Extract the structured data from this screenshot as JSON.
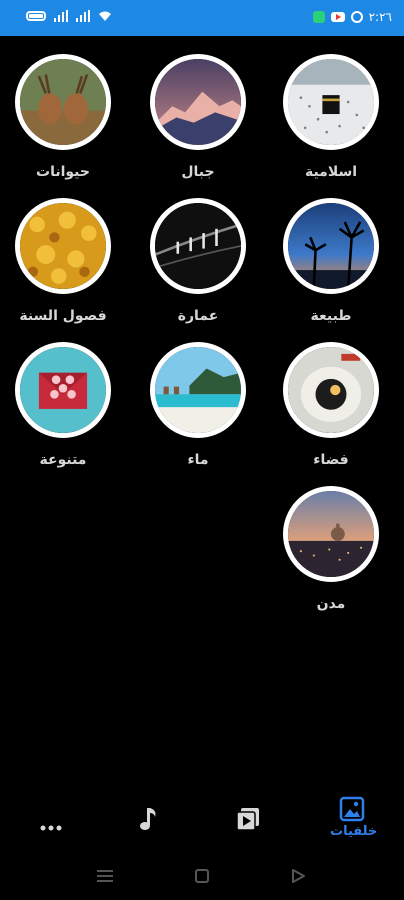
{
  "status_bar": {
    "time": "٢:٢٦",
    "icons": [
      "battery-icon",
      "signal-icon",
      "signal-icon",
      "wifi-icon",
      "chat-app-icon",
      "youtube-icon",
      "whatsapp-icon"
    ]
  },
  "categories": [
    {
      "label": "اسلامية",
      "icon": "kaaba-photo"
    },
    {
      "label": "جبال",
      "icon": "mountains-photo"
    },
    {
      "label": "حيوانات",
      "icon": "deer-photo"
    },
    {
      "label": "طبيعة",
      "icon": "palm-sunset-photo"
    },
    {
      "label": "عمارة",
      "icon": "architecture-photo"
    },
    {
      "label": "فصول السنة",
      "icon": "autumn-leaves-photo"
    },
    {
      "label": "فضاء",
      "icon": "astronaut-photo"
    },
    {
      "label": "ماء",
      "icon": "beach-photo"
    },
    {
      "label": "متنوعة",
      "icon": "hearts-envelope-photo"
    },
    {
      "label": "مدن",
      "icon": "city-photo"
    }
  ],
  "bottom_nav": {
    "wallpapers_label": "خلفيات",
    "items": [
      "wallpapers-icon",
      "video-icon",
      "music-icon",
      "more-icon"
    ]
  },
  "colors": {
    "status_bar": "#1e88e5",
    "active_tab": "#2f80ed",
    "background": "#000000"
  }
}
